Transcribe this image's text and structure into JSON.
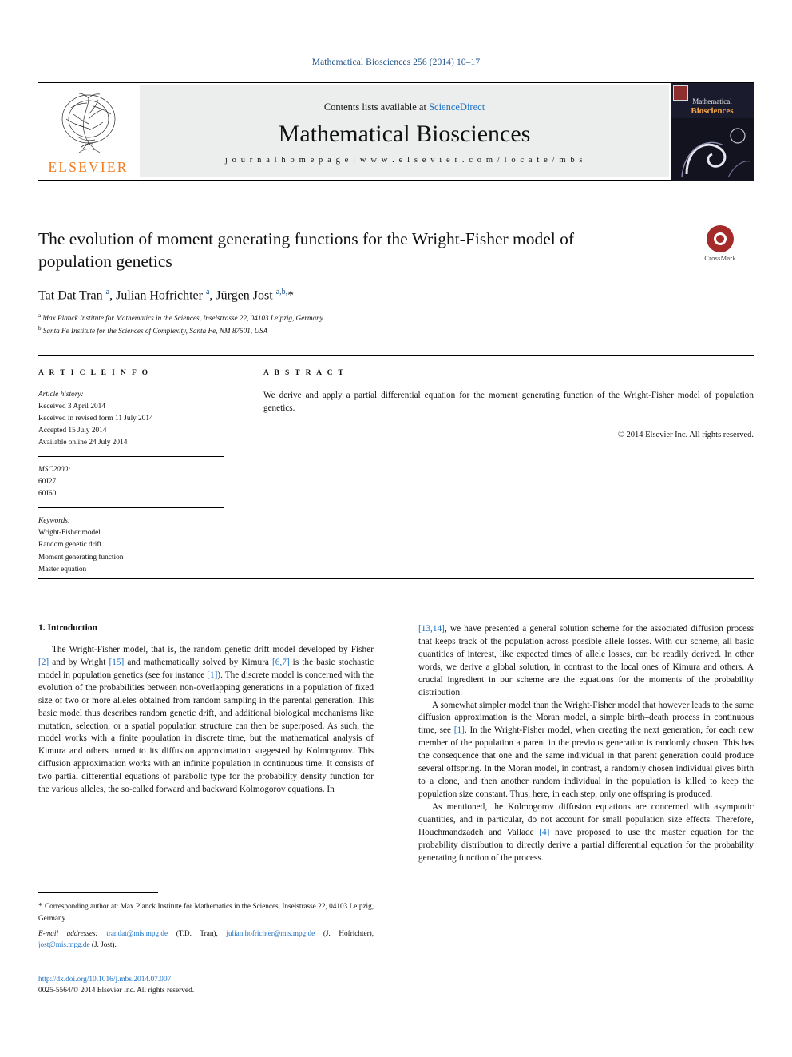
{
  "journal_ref": "Mathematical Biosciences 256 (2014) 10–17",
  "masthead": {
    "contents_prefix": "Contents lists available at ",
    "sciencedirect": "ScienceDirect",
    "journal_title": "Mathematical Biosciences",
    "homepage": "j o u r n a l   h o m e p a g e :   w w w . e l s e v i e r . c o m / l o c a t e / m b s",
    "publisher": "ELSEVIER",
    "cover_line1": "Mathematical",
    "cover_line2": "Biosciences"
  },
  "article": {
    "title": "The evolution of moment generating functions for the Wright-Fisher model of population genetics",
    "crossmark_label": "CrossMark",
    "authors_html": "Tat Dat Tran <sup>a</sup>, Julian Hofrichter <sup>a</sup>, Jürgen Jost <sup>a,b,</sup><span class=\"star\">*</span>",
    "affiliation_a": "Max Planck Institute for Mathematics in the Sciences, Inselstrasse 22, 04103 Leipzig, Germany",
    "affiliation_b": "Santa Fe Institute for the Sciences of Complexity, Santa Fe, NM 87501, USA"
  },
  "article_info": {
    "heading": "A R T I C L E    I N F O",
    "history_label": "Article history:",
    "history": [
      "Received 3 April 2014",
      "Received in revised form 11 July 2014",
      "Accepted 15 July 2014",
      "Available online 24 July 2014"
    ],
    "msc_label": "MSC2000:",
    "msc": [
      "60J27",
      "60J60"
    ],
    "keywords_label": "Keywords:",
    "keywords": [
      "Wright-Fisher model",
      "Random genetic drift",
      "Moment generating function",
      "Master equation"
    ]
  },
  "abstract": {
    "heading": "A B S T R A C T",
    "text": "We derive and apply a partial differential equation for the moment generating function of the Wright-Fisher model of population genetics.",
    "copyright": "© 2014 Elsevier Inc. All rights reserved."
  },
  "body": {
    "section_title": "1. Introduction",
    "left_paragraph_1_pre": "The Wright-Fisher model, that is, the random genetic drift model developed by Fisher ",
    "ref_2": "[2]",
    "left_p1_mid1": " and by Wright ",
    "ref_15": "[15]",
    "left_p1_mid2": " and mathematically solved by Kimura ",
    "ref_67": "[6,7]",
    "left_p1_mid3": " is the basic stochastic model in population genetics (see for instance ",
    "ref_1": "[1]",
    "left_p1_end": "). The discrete model is concerned with the evolution of the probabilities between non-overlapping generations in a population of fixed size of two or more alleles obtained from random sampling in the parental generation. This basic model thus describes random genetic drift, and additional biological mechanisms like mutation, selection, or a spatial population structure can then be superposed. As such, the model works with a finite population in discrete time, but the mathematical analysis of Kimura and others turned to its diffusion approximation suggested by Kolmogorov. This diffusion approximation works with an infinite population in continuous time. It consists of two partial differential equations of parabolic type for the probability density function for the various alleles, the so-called forward and backward Kolmogorov equations. In",
    "right_p1_ref": "[13,14]",
    "right_p1": ", we have presented a general solution scheme for the associated diffusion process that keeps track of the population across possible allele losses. With our scheme, all basic quantities of interest, like expected times of allele losses, can be readily derived. In other words, we derive a global solution, in contrast to the local ones of Kimura and others. A crucial ingredient in our scheme are the equations for the moments of the probability distribution.",
    "right_p2_pre": "A somewhat simpler model than the Wright-Fisher model that however leads to the same diffusion approximation is the Moran model, a simple birth–death process in continuous time, see ",
    "right_p2_ref": "[1]",
    "right_p2_post": ". In the Wright-Fisher model, when creating the next generation, for each new member of the population a parent in the previous generation is randomly chosen. This has the consequence that one and the same individual in that parent generation could produce several offspring. In the Moran model, in contrast, a randomly chosen individual gives birth to a clone, and then another random individual in the population is killed to keep the population size constant. Thus, here, in each step, only one offspring is produced.",
    "right_p3_pre": "As mentioned, the Kolmogorov diffusion equations are concerned with asymptotic quantities, and in particular, do not account for small population size effects. Therefore, Houchmandzadeh and Vallade ",
    "right_p3_ref": "[4]",
    "right_p3_post": " have proposed to use the master equation for the probability distribution to directly derive a partial differential equation for the probability generating function of the process."
  },
  "footnote": {
    "star": "*",
    "corresponding": " Corresponding author at: Max Planck Institute for Mathematics in the Sciences, Inselstrasse 22, 04103 Leipzig, Germany.",
    "email_label": "E-mail addresses:",
    "email1": "trandat@mis.mpg.de",
    "email1_who": " (T.D. Tran), ",
    "email2": "julian.hofrichter@mis.mpg.de",
    "email2_who": " (J. Hofrichter), ",
    "email3": "jost@mis.mpg.de",
    "email3_who": " (J. Jost)."
  },
  "footer": {
    "doi": "http://dx.doi.org/10.1016/j.mbs.2014.07.007",
    "issn_copyright": "0025-5564/© 2014 Elsevier Inc. All rights reserved."
  }
}
